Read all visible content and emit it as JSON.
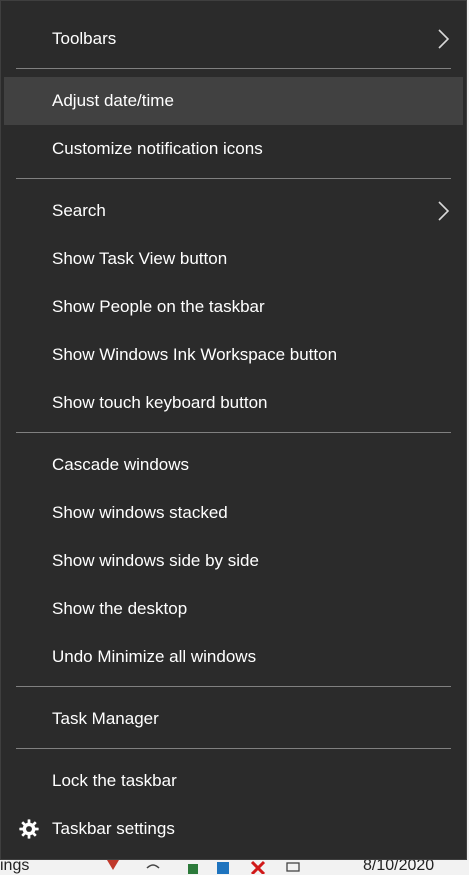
{
  "context_menu": {
    "items": [
      {
        "label": "Toolbars",
        "has_submenu": true
      },
      {
        "label": "Adjust date/time",
        "highlighted": true
      },
      {
        "label": "Customize notification icons"
      },
      {
        "label": "Search",
        "has_submenu": true
      },
      {
        "label": "Show Task View button"
      },
      {
        "label": "Show People on the taskbar"
      },
      {
        "label": "Show Windows Ink Workspace button"
      },
      {
        "label": "Show touch keyboard button"
      },
      {
        "label": "Cascade windows"
      },
      {
        "label": "Show windows stacked"
      },
      {
        "label": "Show windows side by side"
      },
      {
        "label": "Show the desktop"
      },
      {
        "label": "Undo Minimize all windows"
      },
      {
        "label": "Task Manager"
      },
      {
        "label": "Lock the taskbar"
      },
      {
        "label": "Taskbar settings",
        "icon": "gear-icon"
      }
    ]
  },
  "taskbar": {
    "left_text": "ings",
    "date": "8/10/2020"
  },
  "colors": {
    "menu_background": "#2b2b2b",
    "highlight": "#414141",
    "separator": "#808080",
    "text": "#ffffff"
  }
}
